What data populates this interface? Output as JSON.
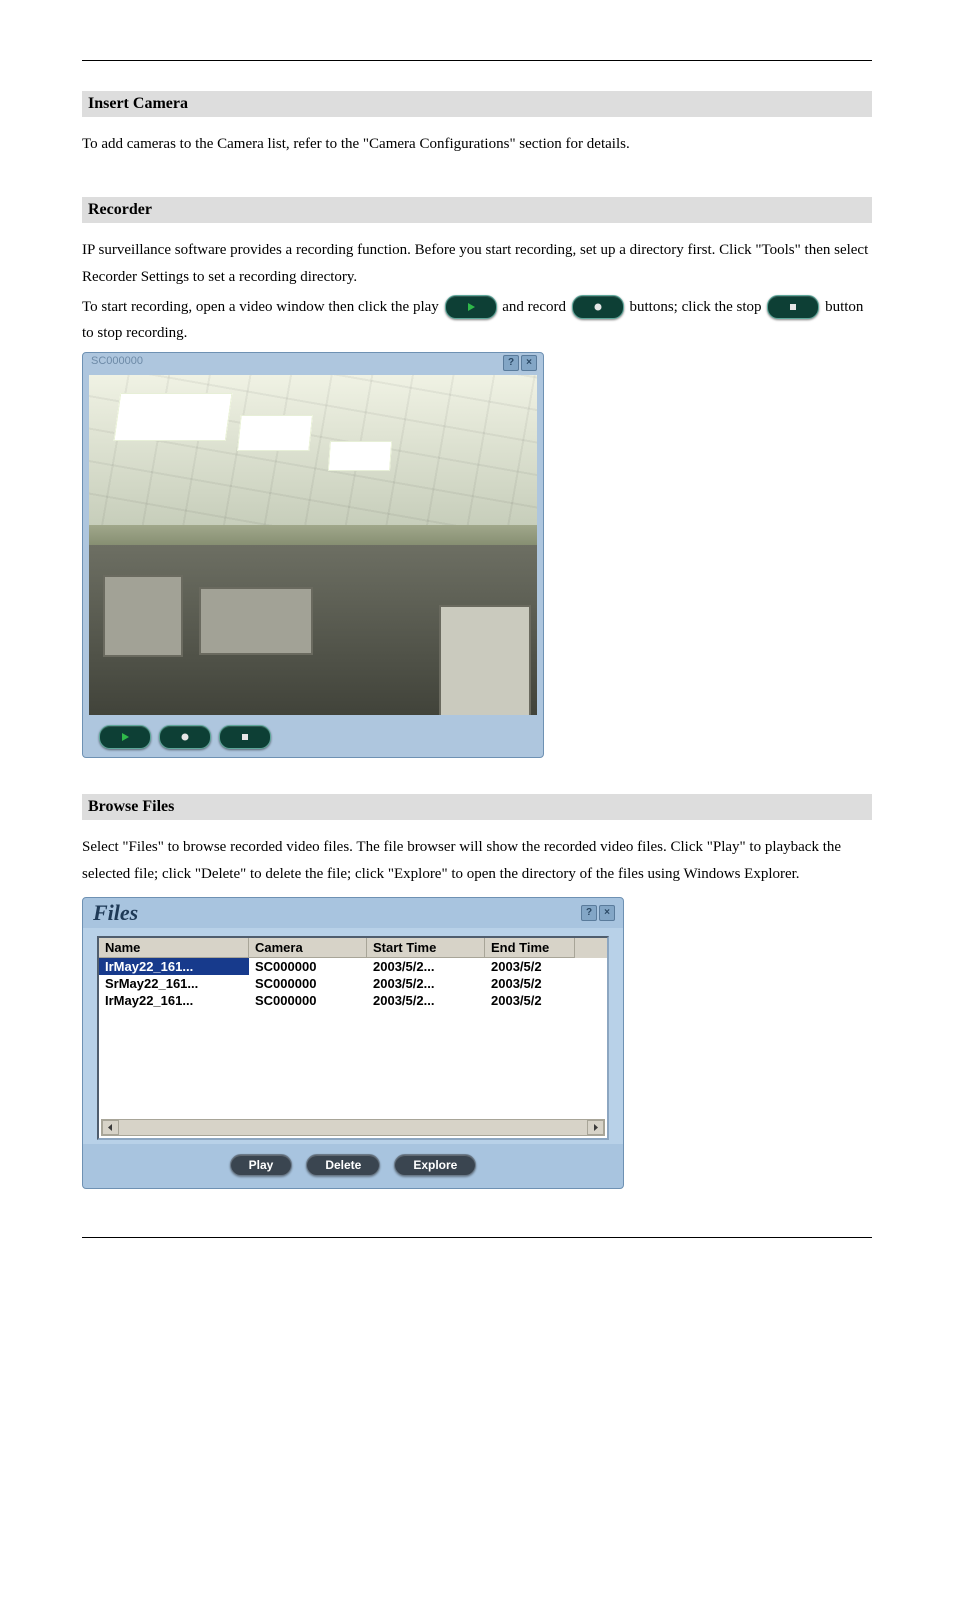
{
  "sections": {
    "insert_camera": {
      "heading": "Insert Camera",
      "paragraph_before": "To add cameras to the Camera list, refer to the \"",
      "link_text": "Camera Configurations",
      "paragraph_after": "\" section for details."
    },
    "recorder": {
      "heading": "Recorder",
      "para1_a": "IP surveillance software provides a recording function. Before you start recording, set up a directory first. Click ",
      "para1_b": "\"Tools\"",
      "para1_c": " then select Recorder Settings to set a recording directory.",
      "para2_a": "To start recording, open a video window then click the play ",
      "para2_b": " and record ",
      "para2_c": " buttons; click the stop ",
      "para2_d": " button to stop recording."
    },
    "browse": {
      "heading": "Browse Files",
      "para_a": "Select ",
      "para_b": "\"Files\"",
      "para_c": " to browse recorded video files. The file browser will show the recorded video files. Click ",
      "para_d": "\"Play\"",
      "para_e": " to playback the selected file; click ",
      "para_f": "\"Delete\"",
      "para_g": " to delete the file; click ",
      "para_h": "\"Explore\"",
      "para_i": " to open the directory of the files using Windows Explorer."
    }
  },
  "player": {
    "title": "SC000000",
    "help": "?",
    "close": "×"
  },
  "files_dialog": {
    "title": "Files",
    "help": "?",
    "close": "×",
    "columns": [
      "Name",
      "Camera",
      "Start Time",
      "End Time"
    ],
    "rows": [
      {
        "name": "IrMay22_161...",
        "camera": "SC000000",
        "start": "2003/5/2...",
        "end": "2003/5/2",
        "selected": true
      },
      {
        "name": "SrMay22_161...",
        "camera": "SC000000",
        "start": "2003/5/2...",
        "end": "2003/5/2",
        "selected": false
      },
      {
        "name": "IrMay22_161...",
        "camera": "SC000000",
        "start": "2003/5/2...",
        "end": "2003/5/2",
        "selected": false
      }
    ],
    "buttons": {
      "play": "Play",
      "delete": "Delete",
      "explore": "Explore"
    }
  }
}
